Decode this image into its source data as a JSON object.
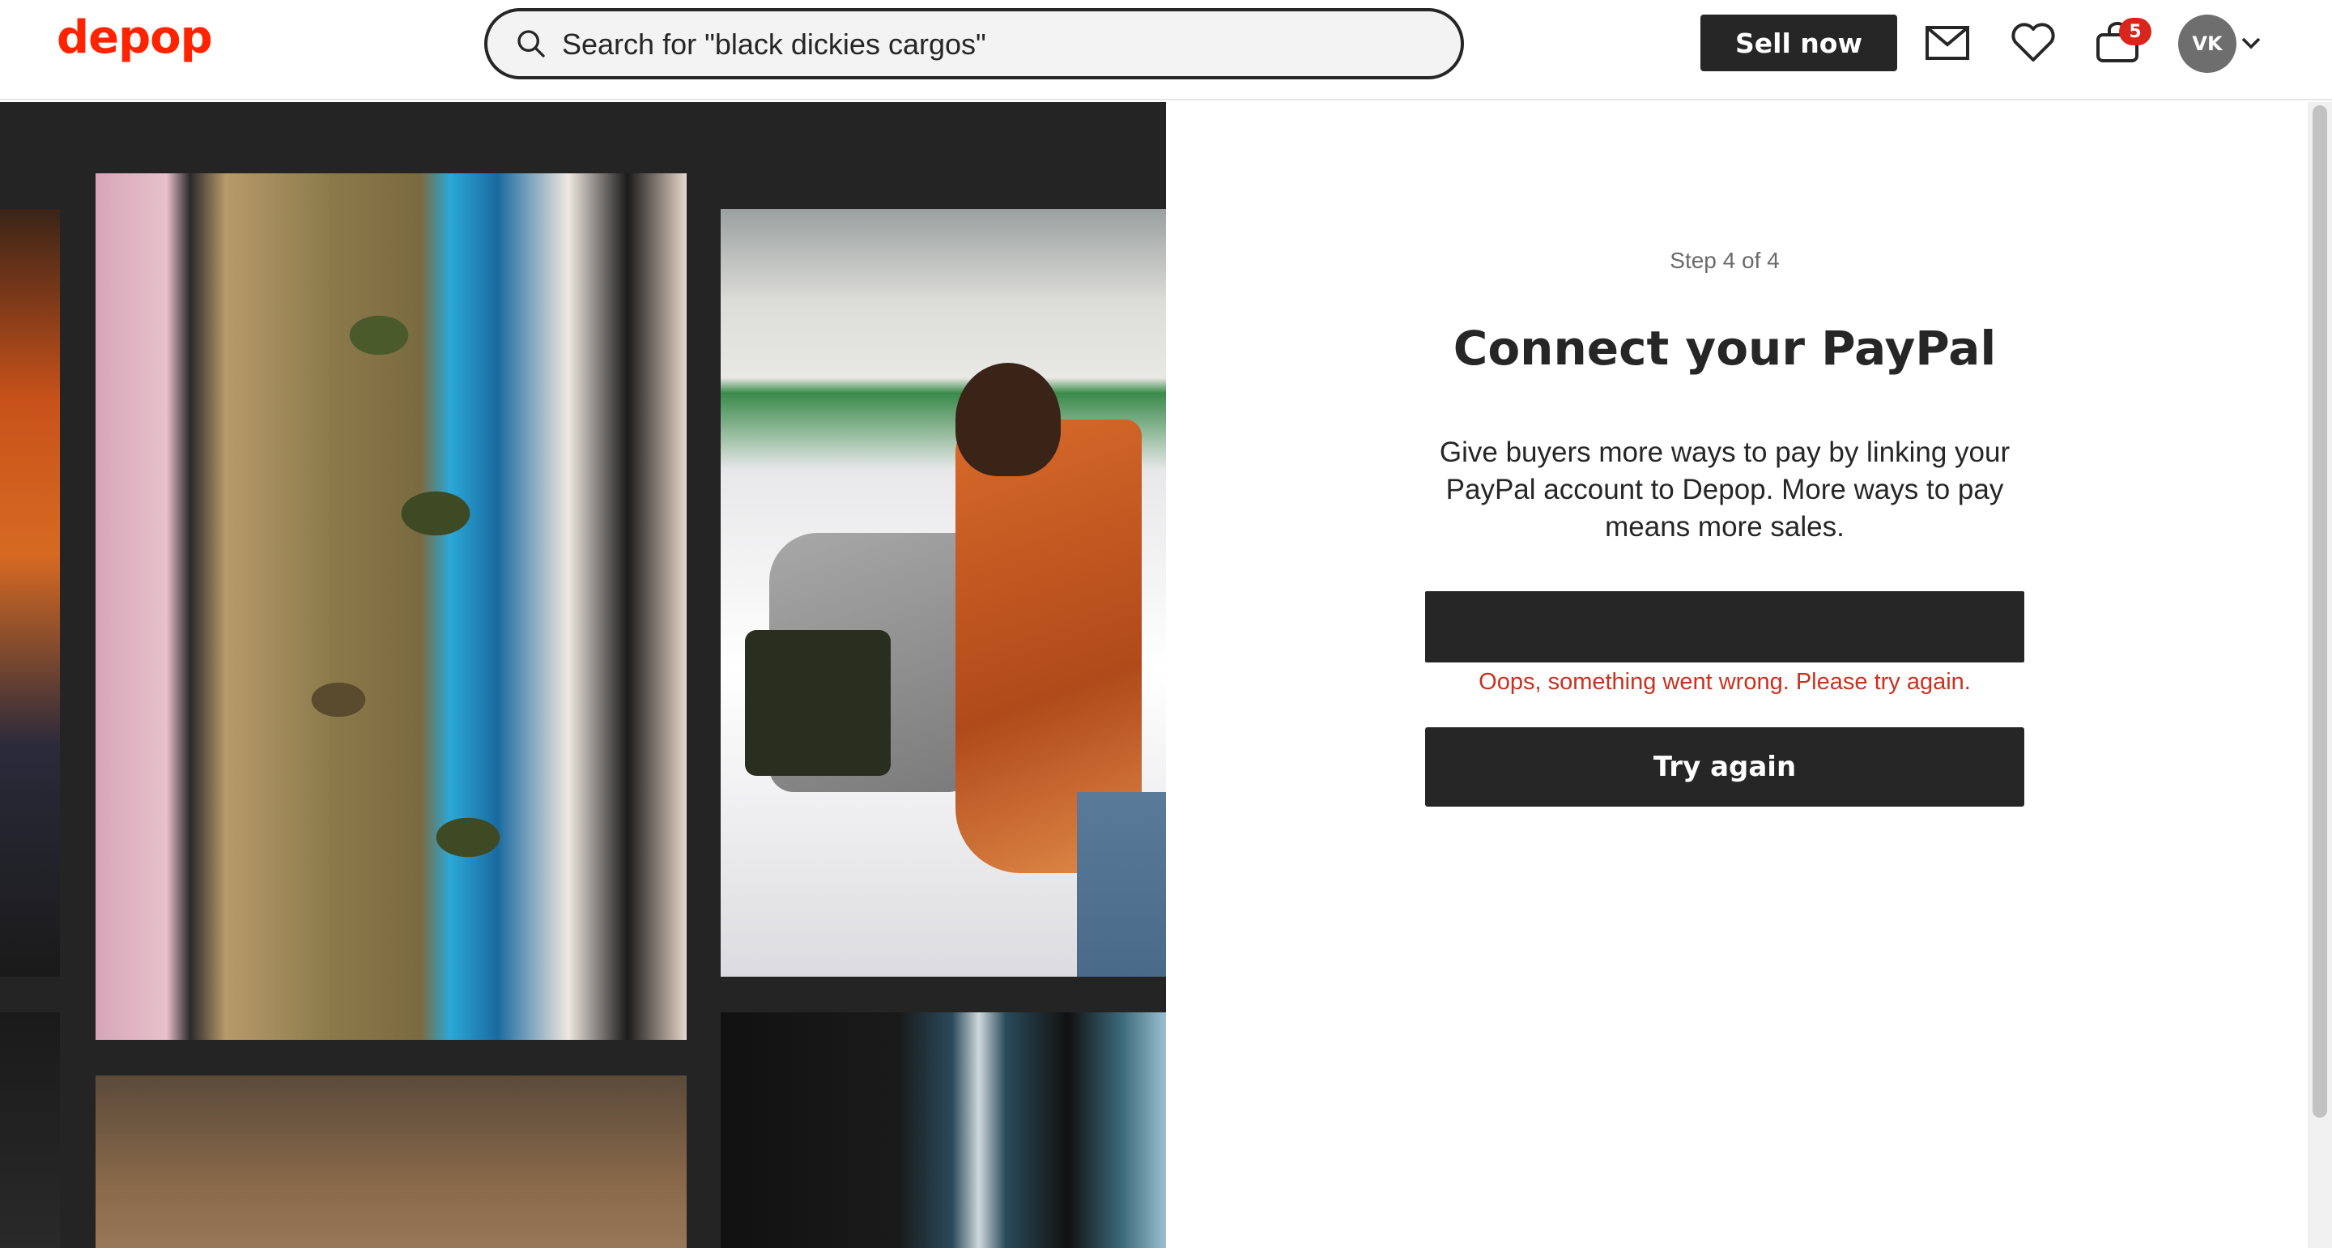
{
  "header": {
    "logo": "depop",
    "search": {
      "value": "Search for \"black dickies cargos\"",
      "placeholder": "Search for \"black dickies cargos\""
    },
    "sell_label": "Sell now",
    "icons": [
      "mail-icon",
      "heart-icon",
      "bag-icon"
    ],
    "bag_count": "5",
    "avatar_initials": "VK"
  },
  "panel": {
    "step": "Step 4 of 4",
    "title": "Connect your PayPal",
    "description": "Give buyers more ways to pay by linking your PayPal account to Depop. More ways to pay means more sales.",
    "error": "Oops, something went wrong. Please try again.",
    "try_again_label": "Try again"
  },
  "colors": {
    "brand": "#ff2300",
    "dark": "#262626",
    "error": "#c8321e",
    "badge": "#d9261c"
  }
}
